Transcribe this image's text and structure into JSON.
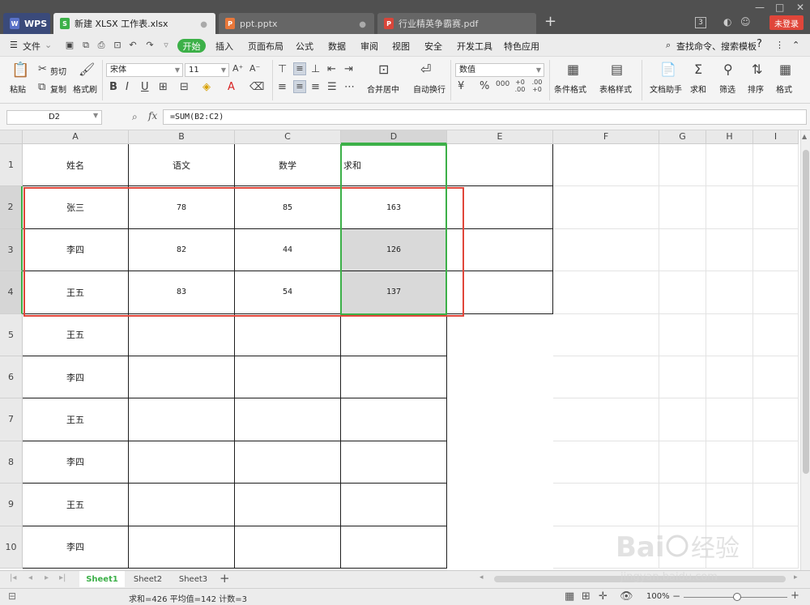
{
  "tabs": {
    "wps": "WPS",
    "xlsx": "新建 XLSX 工作表.xlsx",
    "ppt": "ppt.pptx",
    "pdf": "行业精英争霸赛.pdf",
    "add": "+",
    "count": "3",
    "login": "未登录"
  },
  "menubar": {
    "file": "文件",
    "start": "开始",
    "items": [
      "插入",
      "页面布局",
      "公式",
      "数据",
      "审阅",
      "视图",
      "安全",
      "开发工具",
      "特色应用"
    ],
    "search": "查找命令、搜索模板",
    "help": "?"
  },
  "ribbon": {
    "paste": "粘贴",
    "cut": "剪切",
    "copy": "复制",
    "format_painter": "格式刷",
    "font_name": "宋体",
    "font_size": "11",
    "merge_center": "合并居中",
    "wrap_text": "自动换行",
    "number_format": "数值",
    "percent": "%",
    "thousands": "000",
    "inc_decimal": "+0 .00",
    "dec_decimal": ".00 +0",
    "cond_format": "条件格式",
    "table_style": "表格样式",
    "doc_helper": "文档助手",
    "sum": "求和",
    "filter": "筛选",
    "sort": "排序",
    "format": "格式"
  },
  "formula_bar": {
    "name_box": "D2",
    "fx": "fx",
    "formula": "=SUM(B2:C2)"
  },
  "grid": {
    "columns": [
      "A",
      "B",
      "C",
      "D",
      "E",
      "F",
      "G",
      "H",
      "I"
    ],
    "selected_column": "D",
    "rows": [
      "1",
      "2",
      "3",
      "4",
      "5",
      "6",
      "7",
      "8",
      "9",
      "10"
    ],
    "data": [
      [
        "姓名",
        "语文",
        "数学",
        "求和"
      ],
      [
        "张三",
        "78",
        "85",
        "163"
      ],
      [
        "李四",
        "82",
        "44",
        "126"
      ],
      [
        "王五",
        "83",
        "54",
        "137"
      ],
      [
        "王五",
        "",
        "",
        ""
      ],
      [
        "李四",
        "",
        "",
        ""
      ],
      [
        "王五",
        "",
        "",
        ""
      ],
      [
        "李四",
        "",
        "",
        ""
      ],
      [
        "王五",
        "",
        "",
        ""
      ],
      [
        "李四",
        "",
        "",
        ""
      ]
    ]
  },
  "sheets": [
    "Sheet1",
    "Sheet2",
    "Sheet3"
  ],
  "active_sheet": "Sheet1",
  "status": {
    "summary": "求和=426  平均值=142  计数=3",
    "zoom": "100%"
  },
  "colors": {
    "accent_green": "#3cb048",
    "highlight_red": "#e0463a",
    "selected_fill": "#d9d9d9"
  }
}
